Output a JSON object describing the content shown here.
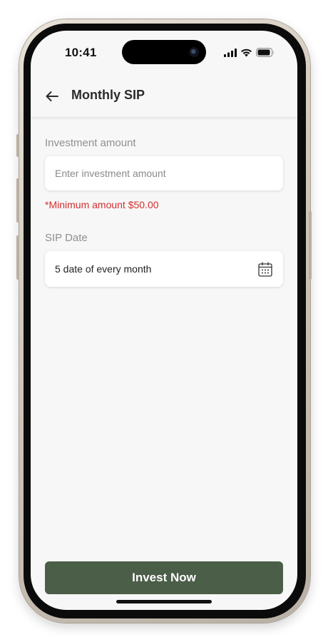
{
  "status_bar": {
    "time": "10:41",
    "icons": [
      "signal-bars-icon",
      "wifi-icon",
      "battery-icon"
    ]
  },
  "header": {
    "back_icon": "arrow-left-icon",
    "title": "Monthly SIP"
  },
  "form": {
    "investment_amount": {
      "label": "Investment amount",
      "value": "",
      "placeholder": "Enter investment amount",
      "note": "*Minimum amount $50.00"
    },
    "sip_date": {
      "label": "SIP Date",
      "value": "5 date of every month",
      "icon": "calendar-icon"
    }
  },
  "footer": {
    "invest_label": "Invest Now"
  },
  "colors": {
    "accent": "#4b5e47",
    "error": "#d32f2f",
    "background": "#f7f7f7",
    "label_gray": "#8f8f8f"
  }
}
